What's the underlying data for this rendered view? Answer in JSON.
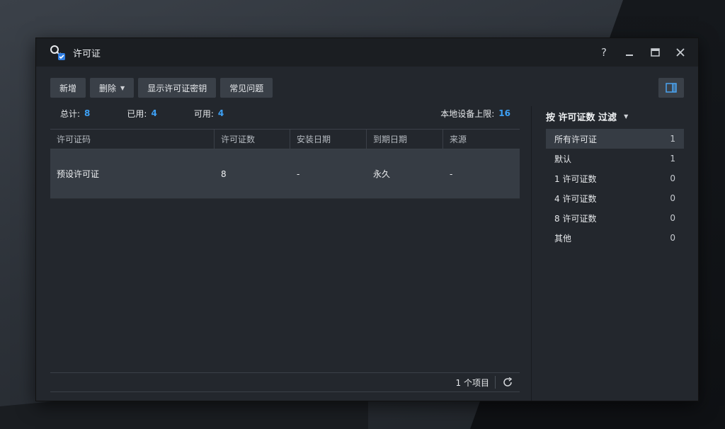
{
  "window": {
    "title": "许可证"
  },
  "toolbar": {
    "add_label": "新增",
    "delete_label": "删除",
    "show_keys_label": "显示许可证密钥",
    "faq_label": "常见问题"
  },
  "stats": {
    "total_label": "总计:",
    "total_value": "8",
    "used_label": "已用:",
    "used_value": "4",
    "available_label": "可用:",
    "available_value": "4",
    "limit_label": "本地设备上限:",
    "limit_value": "16"
  },
  "table": {
    "columns": [
      "许可证码",
      "许可证数",
      "安装日期",
      "到期日期",
      "来源"
    ],
    "rows": [
      {
        "code": "预设许可证",
        "count": "8",
        "install_date": "-",
        "expire_date": "永久",
        "source": "-"
      }
    ]
  },
  "footer": {
    "item_count": "1 个项目"
  },
  "sidebar": {
    "filter_title": "按 许可证数 过滤",
    "items": [
      {
        "label": "所有许可证",
        "count": "1"
      },
      {
        "label": "默认",
        "count": "1"
      },
      {
        "label": "1 许可证数",
        "count": "0"
      },
      {
        "label": "4 许可证数",
        "count": "0"
      },
      {
        "label": "8 许可证数",
        "count": "0"
      },
      {
        "label": "其他",
        "count": "0"
      }
    ],
    "active_index": 0
  },
  "colors": {
    "accent": "#3da0f5",
    "window_bg": "#23272d",
    "selected_row": "#363c44"
  },
  "icons": [
    "license-key-icon",
    "help-icon",
    "minimize-icon",
    "maximize-icon",
    "close-icon",
    "panel-toggle-icon",
    "refresh-icon",
    "chevron-down-icon"
  ]
}
